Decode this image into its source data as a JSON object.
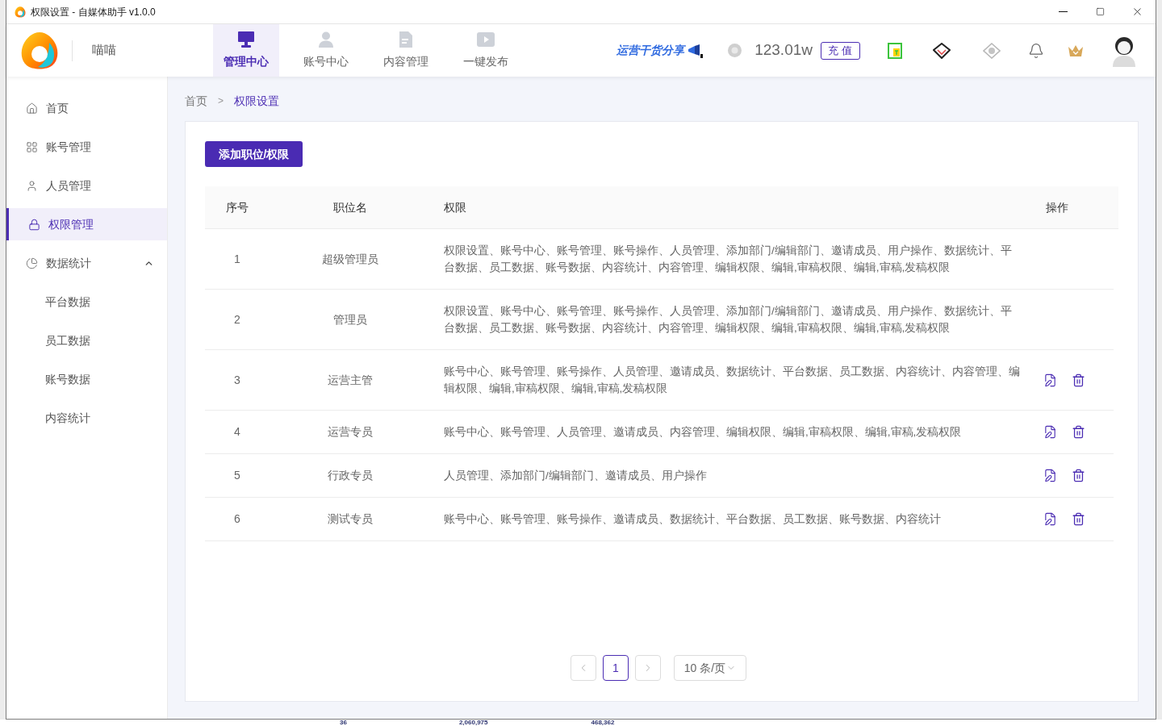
{
  "window": {
    "title": "权限设置 - 自媒体助手 v1.0.0"
  },
  "header": {
    "username": "喵喵",
    "nav": [
      {
        "label": "管理中心",
        "selected": true
      },
      {
        "label": "账号中心",
        "selected": false
      },
      {
        "label": "内容管理",
        "selected": false
      },
      {
        "label": "一键发布",
        "selected": false
      }
    ],
    "promo": "运营干货分享",
    "balance": "123.01w",
    "recharge": "充值"
  },
  "sidebar": {
    "items": [
      {
        "label": "首页",
        "selected": false
      },
      {
        "label": "账号管理",
        "selected": false
      },
      {
        "label": "人员管理",
        "selected": false
      },
      {
        "label": "权限管理",
        "selected": true
      },
      {
        "label": "数据统计",
        "selected": false,
        "expanded": true,
        "children": [
          {
            "label": "平台数据",
            "selected": false
          },
          {
            "label": "员工数据",
            "selected": false
          },
          {
            "label": "账号数据",
            "selected": false
          },
          {
            "label": "内容统计",
            "selected": false
          }
        ]
      }
    ]
  },
  "breadcrumb": {
    "separator": ">",
    "items": [
      {
        "label": "首页",
        "selected": false
      },
      {
        "label": "权限设置",
        "selected": true
      }
    ]
  },
  "add_button": "添加职位/权限",
  "table": {
    "columns": [
      "序号",
      "职位名",
      "权限",
      "操作"
    ],
    "rows": [
      {
        "index": "1",
        "role": "超级管理员",
        "permissions": "权限设置、账号中心、账号管理、账号操作、人员管理、添加部门/编辑部门、邀请成员、用户操作、数据统计、平台数据、员工数据、账号数据、内容统计、内容管理、编辑权限、编辑,审稿权限、编辑,审稿,发稿权限",
        "actions": false
      },
      {
        "index": "2",
        "role": "管理员",
        "permissions": "权限设置、账号中心、账号管理、账号操作、人员管理、添加部门/编辑部门、邀请成员、用户操作、数据统计、平台数据、员工数据、账号数据、内容统计、内容管理、编辑权限、编辑,审稿权限、编辑,审稿,发稿权限",
        "actions": false
      },
      {
        "index": "3",
        "role": "运营主管",
        "permissions": "账号中心、账号管理、账号操作、人员管理、邀请成员、数据统计、平台数据、员工数据、内容统计、内容管理、编辑权限、编辑,审稿权限、编辑,审稿,发稿权限",
        "actions": true
      },
      {
        "index": "4",
        "role": "运营专员",
        "permissions": "账号中心、账号管理、人员管理、邀请成员、内容管理、编辑权限、编辑,审稿权限、编辑,审稿,发稿权限",
        "actions": true
      },
      {
        "index": "5",
        "role": "行政专员",
        "permissions": "人员管理、添加部门/编辑部门、邀请成员、用户操作",
        "actions": true
      },
      {
        "index": "6",
        "role": "测试专员",
        "permissions": "账号中心、账号管理、账号操作、邀请成员、数据统计、平台数据、员工数据、账号数据、内容统计",
        "actions": true
      }
    ]
  },
  "pagination": {
    "pages": [
      {
        "label": "1",
        "selected": true
      }
    ],
    "page_size": "10 条/页"
  },
  "background_window": {
    "values": [
      "36",
      "2,060,975",
      "468,362"
    ]
  }
}
